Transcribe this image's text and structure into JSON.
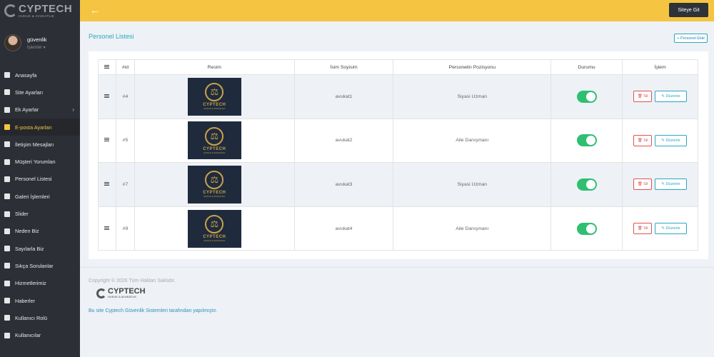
{
  "logo": {
    "brand": "CYPTECH",
    "sub": "HUKUK & AVUKATLIK"
  },
  "user": {
    "name": "güvenlik",
    "role": "İşlemler ▾"
  },
  "nav": [
    {
      "label": "Anasayfa",
      "icon": "grid-icon"
    },
    {
      "label": "Site Ayarları",
      "icon": "gear-icon"
    },
    {
      "label": "Ek Ayarlar",
      "icon": "gear-icon",
      "chevron": "›"
    },
    {
      "label": "E-posta Ayarları",
      "icon": "envelope-icon",
      "active": true
    },
    {
      "label": "İletişim Mesajları",
      "icon": "envelope-icon"
    },
    {
      "label": "Müşteri Yorumları",
      "icon": "comments-icon"
    },
    {
      "label": "Personel Listesi",
      "icon": "users-icon"
    },
    {
      "label": "Galeri İşlemleri",
      "icon": "grid-icon"
    },
    {
      "label": "Slider",
      "icon": "layers-icon"
    },
    {
      "label": "Neden Biz",
      "icon": "database-icon"
    },
    {
      "label": "Sayılarla Biz",
      "icon": "database-icon"
    },
    {
      "label": "Sıkça Sorulanlar",
      "icon": "question-icon"
    },
    {
      "label": "Hizmetlerimiz",
      "icon": "tooth-icon"
    },
    {
      "label": "Haberler",
      "icon": "newspaper-icon"
    },
    {
      "label": "Kullanıcı Rolü",
      "icon": "eye-icon"
    },
    {
      "label": "Kullanıcılar",
      "icon": "user-icon"
    }
  ],
  "topbar": {
    "back_icon": "←",
    "site_button": "Siteye Git"
  },
  "page": {
    "title": "Personel Listesi",
    "add_button": "+ Personel Ekle"
  },
  "table": {
    "headers": [
      "≡",
      "#id",
      "Resim",
      "İsim Soyisim",
      "Personelin Pozisyonu",
      "Durumu",
      "İşlem"
    ],
    "rows": [
      {
        "id": "#4",
        "name": "avukat1",
        "position": "Siyasi Uzman",
        "status": "on"
      },
      {
        "id": "#5",
        "name": "avukat2",
        "position": "Aile Danışmanı",
        "status": "on"
      },
      {
        "id": "#7",
        "name": "avukat3",
        "position": "Siyasi Uzman",
        "status": "on"
      },
      {
        "id": "#9",
        "name": "avukat4",
        "position": "Aile Danışmanı",
        "status": "on"
      }
    ],
    "delete_label": "🗑 Sil",
    "edit_label": "✎ Düzenle",
    "thumb_brand": "CYPTECH",
    "thumb_sub": "HUKUK & AVUKATLIK"
  },
  "footer": {
    "copyright": "Copyright © 2026 Tüm Hakları Saklıdır.",
    "brand": "CYPTECH",
    "sub": "HUKUK & AVUKATLIK",
    "made_by": "Bu site Cyptech Güvenlik Sistemleri tarafından yapılmıştır."
  },
  "colors": {
    "accent": "#f5c542",
    "sidebar": "#2c2f36",
    "toggle_on": "#2fbf71",
    "link": "#2aa8c4",
    "danger": "#e0524f"
  }
}
